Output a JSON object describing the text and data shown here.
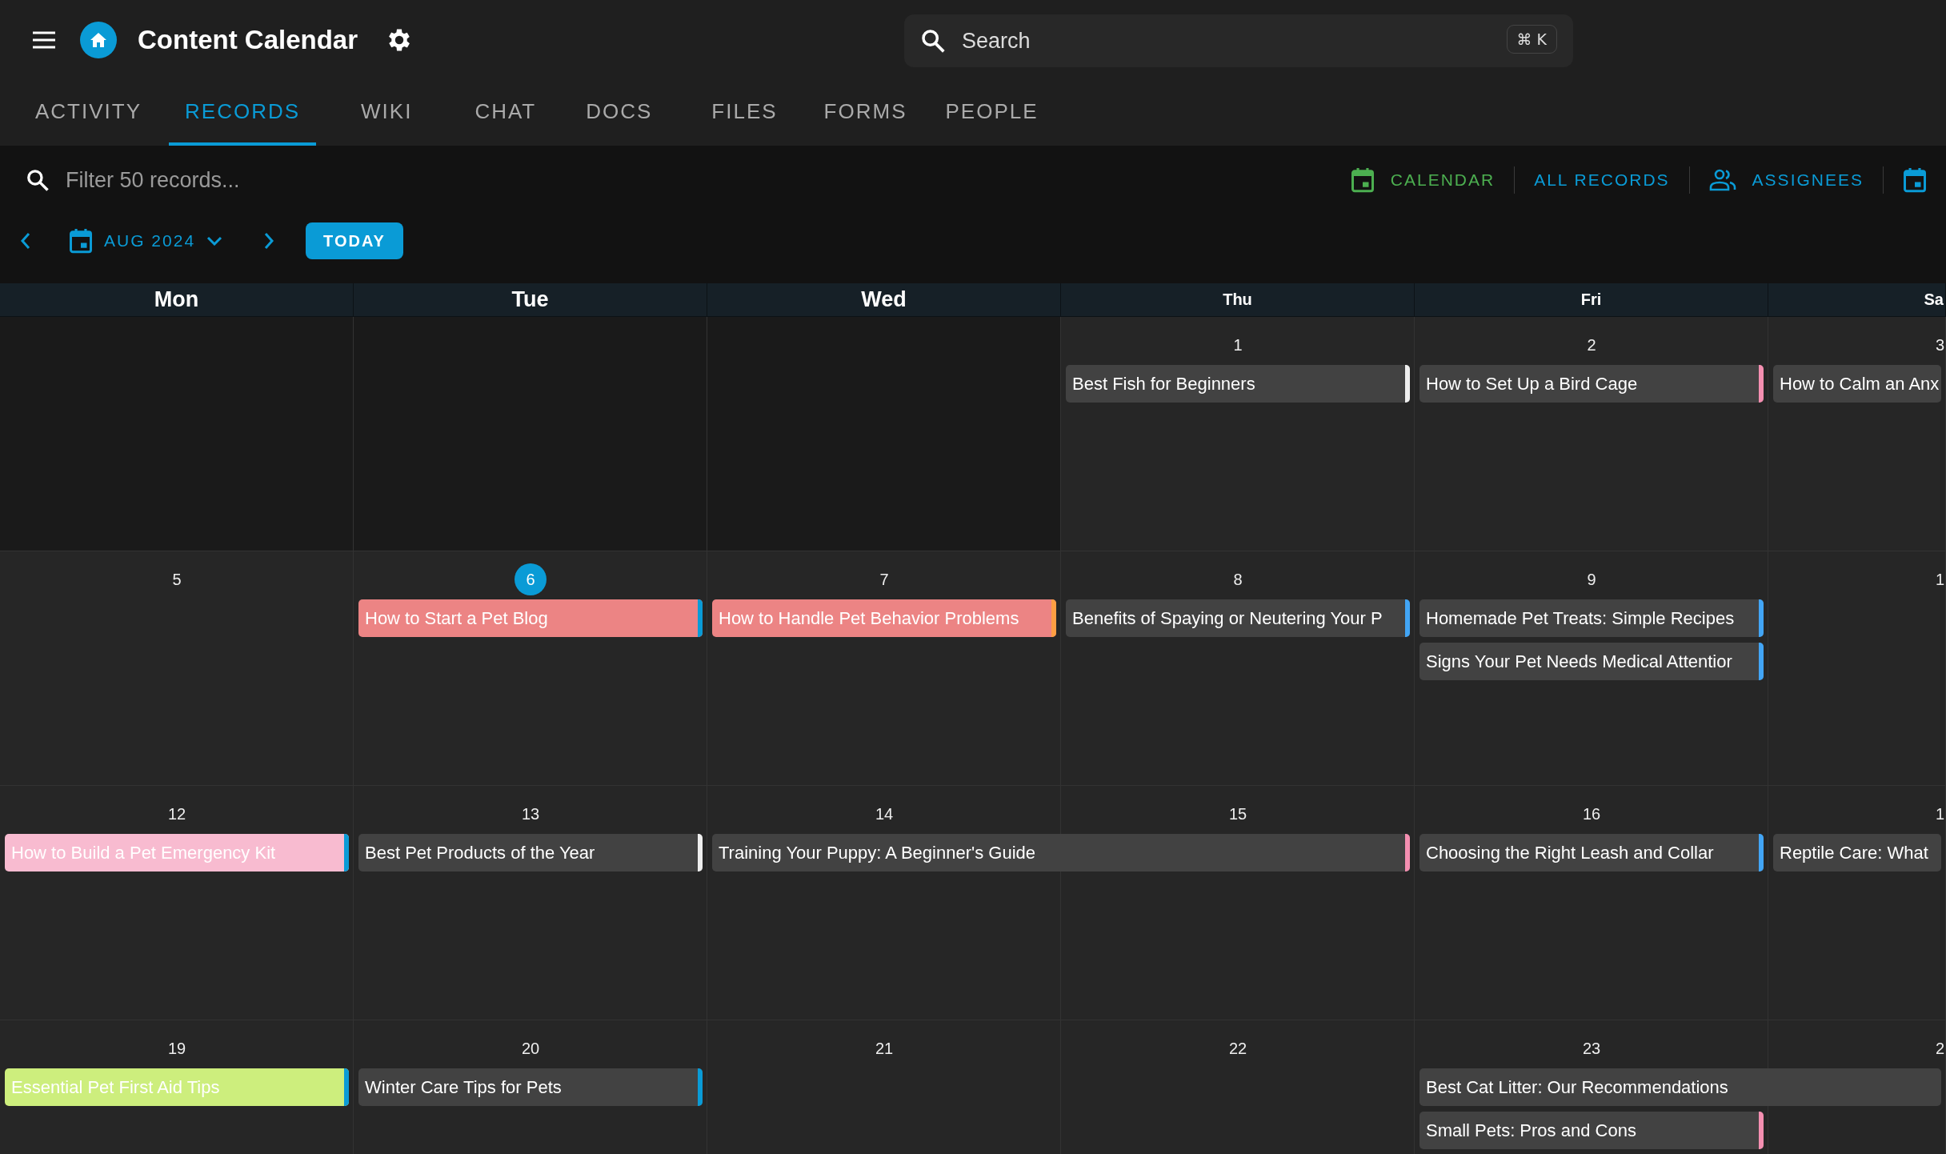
{
  "app_bar": {
    "title": "Content Calendar",
    "search": {
      "placeholder": "Search",
      "shortcut": "⌘ K"
    }
  },
  "tabs": [
    {
      "label": "ACTIVITY",
      "selected": false
    },
    {
      "label": "RECORDS",
      "selected": true
    },
    {
      "label": "WIKI",
      "selected": false
    },
    {
      "label": "CHAT",
      "selected": false
    },
    {
      "label": "DOCS",
      "selected": false
    },
    {
      "label": "FILES",
      "selected": false
    },
    {
      "label": "FORMS",
      "selected": false
    },
    {
      "label": "PEOPLE",
      "selected": false
    }
  ],
  "toolbar": {
    "filter": {
      "placeholder": "Filter 50 records..."
    },
    "views": [
      {
        "label": "CALENDAR",
        "kind": "calendar",
        "selected": true
      },
      {
        "label": "ALL RECORDS",
        "kind": "text",
        "selected": false
      },
      {
        "label": "ASSIGNEES",
        "kind": "people",
        "selected": false
      },
      {
        "kind": "calendar",
        "selected": false
      }
    ]
  },
  "month_nav": {
    "month": "AUG 2024",
    "today_button": "TODAY"
  },
  "weekdays": [
    "Mon",
    "Tue",
    "Wed",
    "Thu",
    "Fri",
    "Sa"
  ],
  "weeks": [
    {
      "days": [
        {
          "outside": true
        },
        {
          "outside": true
        },
        {
          "outside": true
        },
        {
          "date": "1",
          "outside": false,
          "today": false,
          "events": [
            {
              "title": "Best Fish for Beginners",
              "kind": "single",
              "category": {
                "color": "#424242"
              },
              "color": "#eeeeee"
            }
          ]
        },
        {
          "date": "2",
          "outside": false,
          "today": false,
          "events": [
            {
              "title": "How to Set Up a Bird Cage",
              "kind": "single",
              "category": {
                "color": "#424242"
              },
              "color": "#f48fb1"
            }
          ]
        },
        {
          "date": "3",
          "outside": false,
          "today": false,
          "events": [
            {
              "title": "How to Calm an Anx",
              "kind": "single",
              "category": {
                "color": "#424242"
              }
            }
          ]
        }
      ]
    },
    {
      "days": [
        {
          "date": "5",
          "outside": false,
          "today": false
        },
        {
          "date": "6",
          "outside": false,
          "today": true,
          "events": [
            {
              "title": "How to Start a Pet Blog",
              "kind": "single",
              "category": {
                "color": "#ec8484"
              },
              "color": "#0a9bd6"
            }
          ]
        },
        {
          "date": "7",
          "outside": false,
          "today": false,
          "events": [
            {
              "title": "How to Handle Pet Behavior Problems",
              "kind": "single",
              "category": {
                "color": "#ec8484"
              },
              "color": "#ff9f43"
            }
          ]
        },
        {
          "date": "8",
          "outside": false,
          "today": false,
          "events": [
            {
              "title": "Benefits of Spaying or Neutering Your P",
              "kind": "single",
              "category": {
                "color": "#424242"
              },
              "color": "#42a5f5"
            }
          ]
        },
        {
          "date": "9",
          "outside": false,
          "today": false,
          "events": [
            {
              "title": "Homemade Pet Treats: Simple Recipes",
              "kind": "single",
              "category": {
                "color": "#424242"
              },
              "color": "#42a5f5"
            },
            {
              "title": "Signs Your Pet Needs Medical Attentior",
              "kind": "single",
              "category": {
                "color": "#424242"
              },
              "color": "#42a5f5"
            }
          ]
        },
        {
          "date": "1",
          "outside": false,
          "today": false
        }
      ]
    },
    {
      "days": [
        {
          "date": "12",
          "outside": false,
          "today": false,
          "events": [
            {
              "title": "How to Build a Pet Emergency Kit",
              "kind": "single",
              "category": {
                "color": "#f8bbd0"
              },
              "color": "#0a9bd6"
            }
          ]
        },
        {
          "date": "13",
          "outside": false,
          "today": false,
          "events": [
            {
              "title": "Best Pet Products of the Year",
              "kind": "single",
              "category": {
                "color": "#424242"
              },
              "color": "#eeeeee"
            }
          ]
        },
        {
          "date": "14",
          "outside": false,
          "today": false,
          "events": [
            {
              "title": "Training Your Puppy: A Beginner's Guide",
              "kind": "two-day",
              "category": {
                "color": "#424242"
              },
              "color": "#f48fb1"
            }
          ]
        },
        {
          "date": "15",
          "outside": false,
          "today": false
        },
        {
          "date": "16",
          "outside": false,
          "today": false,
          "events": [
            {
              "title": "Choosing the Right Leash and Collar",
              "kind": "single",
              "category": {
                "color": "#424242"
              },
              "color": "#42a5f5"
            }
          ]
        },
        {
          "date": "1",
          "outside": false,
          "today": false,
          "events": [
            {
              "title": "Reptile Care: What",
              "kind": "single",
              "category": {
                "color": "#424242"
              }
            }
          ]
        }
      ]
    },
    {
      "days": [
        {
          "date": "19",
          "outside": false,
          "today": false,
          "events": [
            {
              "title": "Essential Pet First Aid Tips",
              "kind": "single",
              "category": {
                "color": "#cdee7d"
              },
              "color": "#0a9bd6"
            }
          ]
        },
        {
          "date": "20",
          "outside": false,
          "today": false,
          "events": [
            {
              "title": "Winter Care Tips for Pets",
              "kind": "single",
              "category": {
                "color": "#424242"
              },
              "color": "#0a9bd6"
            }
          ]
        },
        {
          "date": "21",
          "outside": false,
          "today": false
        },
        {
          "date": "22",
          "outside": false,
          "today": false
        },
        {
          "date": "23",
          "outside": false,
          "today": false,
          "events": [
            {
              "title": "Best Cat Litter: Our Recommendations",
              "kind": "two-day",
              "category": {
                "color": "#424242"
              }
            },
            {
              "title": "Small Pets: Pros and Cons",
              "kind": "single",
              "category": {
                "color": "#424242"
              },
              "color": "#f48fb1"
            }
          ]
        },
        {
          "date": "2",
          "outside": false,
          "today": false
        }
      ]
    }
  ]
}
